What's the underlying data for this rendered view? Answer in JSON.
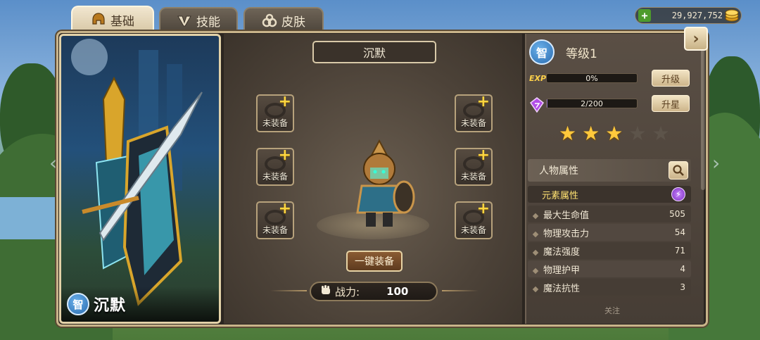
{
  "tabs": [
    {
      "label": "基础",
      "icon": "helmet-icon",
      "active": true
    },
    {
      "label": "技能",
      "icon": "skill-icon",
      "active": false
    },
    {
      "label": "皮肤",
      "icon": "skin-icon",
      "active": false
    }
  ],
  "currency": {
    "amount": "29,927,752",
    "icon": "coin-icon"
  },
  "hero": {
    "class_badge": "智",
    "name": "沉默",
    "title": "沉默"
  },
  "equipment": {
    "slots": [
      {
        "label": "未装备"
      },
      {
        "label": "未装备"
      },
      {
        "label": "未装备"
      },
      {
        "label": "未装备"
      },
      {
        "label": "未装备"
      },
      {
        "label": "未装备"
      }
    ],
    "auto_equip_label": "一键装备",
    "power_label": "战力:",
    "power_value": "100"
  },
  "stats_panel": {
    "class_badge": "智",
    "level_text": "等级1",
    "exp_label": "EXP",
    "exp_text": "0%",
    "exp_fraction": 0,
    "upgrade_label": "升级",
    "shard_text": "2/200",
    "shard_fraction": 0.01,
    "star_up_label": "升星",
    "stars_total": 5,
    "stars_filled": 3,
    "section_title": "人物属性",
    "element_label": "元素属性",
    "attributes": [
      {
        "name": "最大生命值",
        "value": "505"
      },
      {
        "name": "物理攻击力",
        "value": "54"
      },
      {
        "name": "魔法强度",
        "value": "71"
      },
      {
        "name": "物理护甲",
        "value": "4"
      },
      {
        "name": "魔法抗性",
        "value": "3"
      }
    ],
    "follow_label": "关注"
  },
  "colors": {
    "accent_gold": "#ffc93c",
    "frame_border": "#c9b48a",
    "badge_blue": "#2a6cb0"
  }
}
